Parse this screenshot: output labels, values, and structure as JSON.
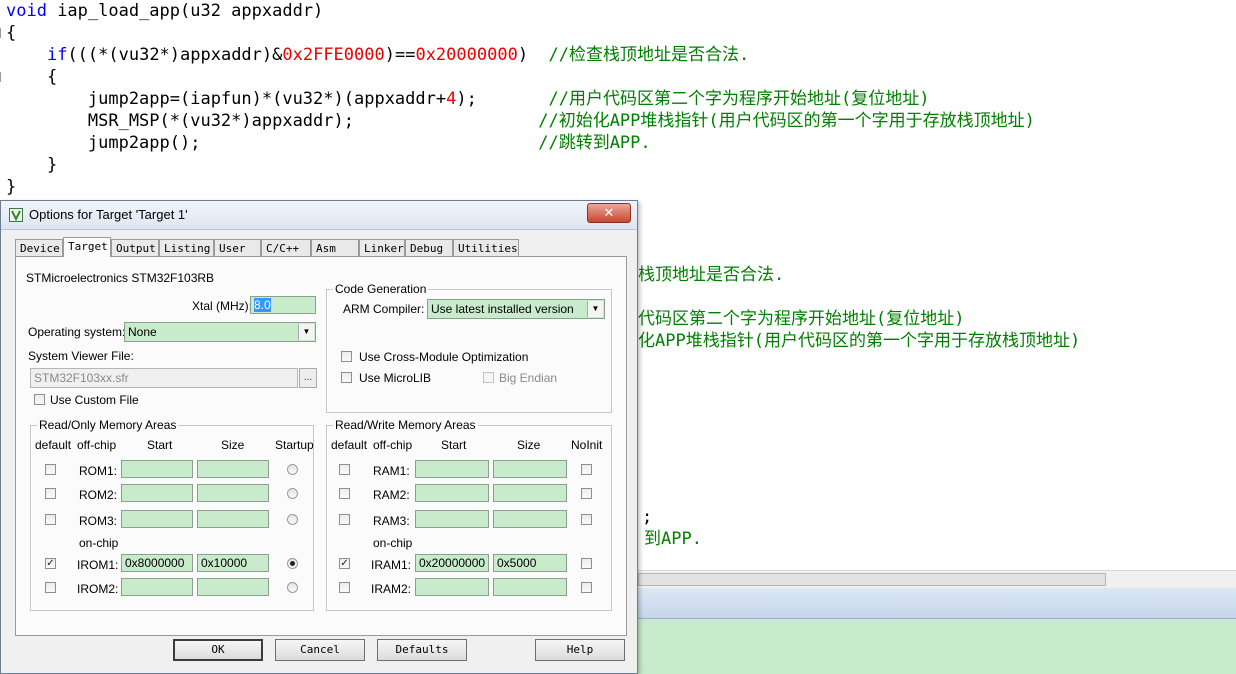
{
  "code": {
    "line1": {
      "kw": "void",
      "rest": " iap_load_app(u32 appxaddr)"
    },
    "line2": "{",
    "line3": {
      "indent": "    ",
      "kw": "if",
      "a": "(((*(vu32*)appxaddr)&",
      "n1": "0x2FFE0000",
      "b": ")==",
      "n2": "0x20000000",
      "c": ")  ",
      "comment": "//检查栈顶地址是否合法."
    },
    "line4": "    {",
    "line5": {
      "a": "        jump2app=(iapfun)*(vu32*)(appxaddr+",
      "n": "4",
      "b": ");       ",
      "comment": "//用户代码区第二个字为程序开始地址(复位地址)"
    },
    "line6": {
      "a": "        MSR_MSP(*(vu32*)appxaddr);                  ",
      "comment": "//初始化APP堆栈指针(用户代码区的第一个字用于存放栈顶地址)"
    },
    "line7": {
      "a": "        jump2app();                                 ",
      "comment": "//跳转到APP."
    },
    "line8": "    }",
    "line9": "}",
    "behind": {
      "l1": "栈顶地址是否合法.",
      "l2": "代码区第二个字为程序开始地址(复位地址)",
      "l3": "化APP堆栈指针(用户代码区的第一个字用于存放栈顶地址)",
      "l4": ";",
      "l5": "到APP."
    }
  },
  "dialog": {
    "title": "Options for Target 'Target 1'",
    "close": "✕",
    "tabs": [
      "Device",
      "Target",
      "Output",
      "Listing",
      "User",
      "C/C++",
      "Asm",
      "Linker",
      "Debug",
      "Utilities"
    ],
    "device": "STMicroelectronics STM32F103RB",
    "xtal_label": "Xtal (MHz):",
    "xtal_value": "8.0",
    "os_label": "Operating system:",
    "os_value": "None",
    "svf_label": "System Viewer File:",
    "svf_value": "STM32F103xx.sfr",
    "browse": "...",
    "custom_file": "Use Custom File",
    "codegen": {
      "title": "Code Generation",
      "compiler_label": "ARM Compiler:",
      "compiler_value": "Use latest installed version",
      "cross_module": "Use Cross-Module Optimization",
      "microlib": "Use MicroLIB",
      "big_endian": "Big Endian"
    },
    "ro": {
      "title": "Read/Only Memory Areas",
      "h_default": "default",
      "h_offchip": "off-chip",
      "h_start": "Start",
      "h_size": "Size",
      "h_startup": "Startup",
      "onchip": "on-chip",
      "rows": [
        {
          "name": "ROM1:",
          "start": "",
          "size": "",
          "checked": false,
          "startup": false
        },
        {
          "name": "ROM2:",
          "start": "",
          "size": "",
          "checked": false,
          "startup": false
        },
        {
          "name": "ROM3:",
          "start": "",
          "size": "",
          "checked": false,
          "startup": false
        },
        {
          "name": "IROM1:",
          "start": "0x8000000",
          "size": "0x10000",
          "checked": true,
          "startup": true
        },
        {
          "name": "IROM2:",
          "start": "",
          "size": "",
          "checked": false,
          "startup": false
        }
      ]
    },
    "rw": {
      "title": "Read/Write Memory Areas",
      "h_default": "default",
      "h_offchip": "off-chip",
      "h_start": "Start",
      "h_size": "Size",
      "h_noinit": "NoInit",
      "onchip": "on-chip",
      "rows": [
        {
          "name": "RAM1:",
          "start": "",
          "size": "",
          "checked": false
        },
        {
          "name": "RAM2:",
          "start": "",
          "size": "",
          "checked": false
        },
        {
          "name": "RAM3:",
          "start": "",
          "size": "",
          "checked": false
        },
        {
          "name": "IRAM1:",
          "start": "0x20000000",
          "size": "0x5000",
          "checked": true
        },
        {
          "name": "IRAM2:",
          "start": "",
          "size": "",
          "checked": false
        }
      ]
    },
    "buttons": {
      "ok": "OK",
      "cancel": "Cancel",
      "defaults": "Defaults",
      "help": "Help"
    }
  },
  "colors": {
    "field_bg": "#c8ebcc",
    "keyword": "#0000ff",
    "number": "#ee0000",
    "comment": "#008000"
  }
}
